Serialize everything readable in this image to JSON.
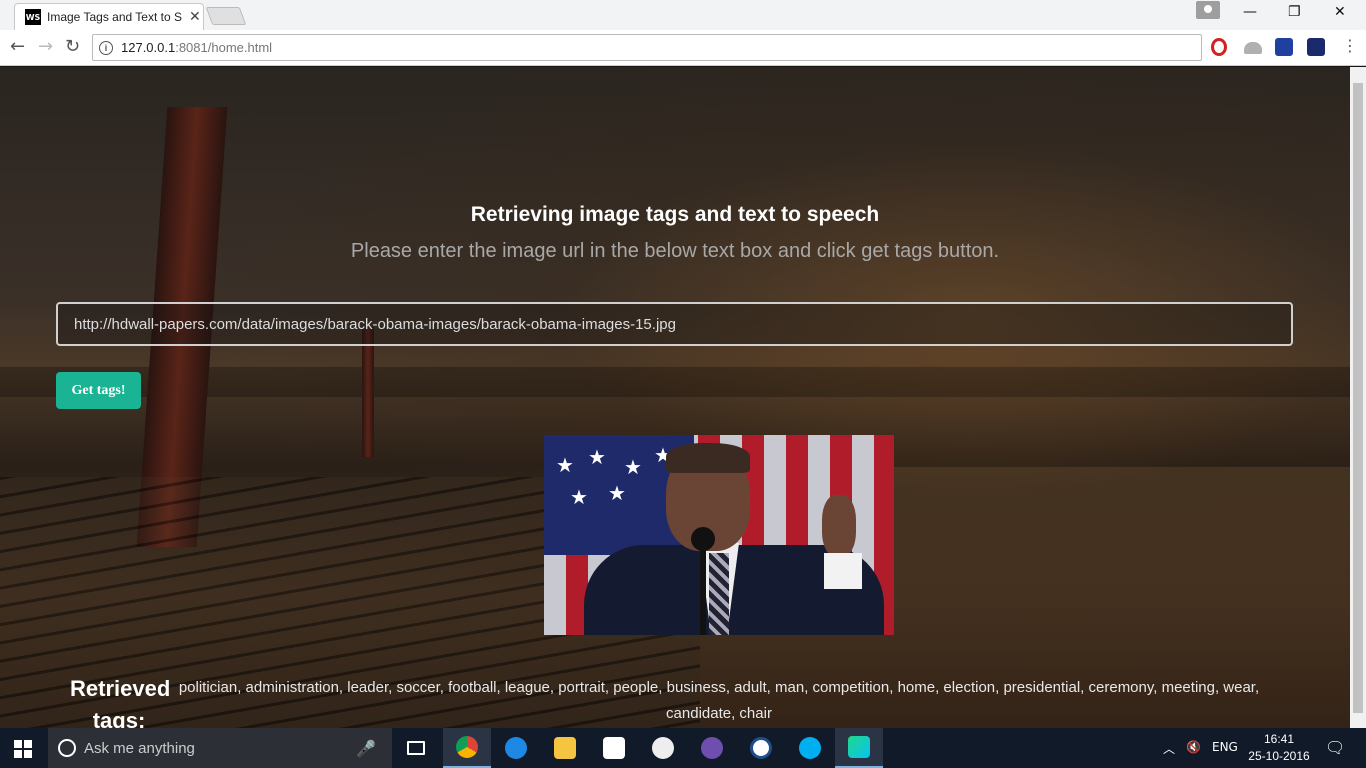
{
  "browser": {
    "tab_title": "Image Tags and Text to S",
    "tab_favicon": "WS",
    "url_host": "127.0.0.1",
    "url_rest": ":8081/home.html"
  },
  "page": {
    "heading": "Retrieving image tags and text to speech",
    "subheading": "Please enter the image url in the below text box and click get tags button.",
    "url_value": "http://hdwall-papers.com/data/images/barack-obama-images/barack-obama-images-15.jpg",
    "button_label": "Get tags!",
    "tags_label": "Retrieved tags:",
    "tags": "politician, administration, leader, soccer, football, league, portrait, people, business, adult, man, competition, home, election, presidential, ceremony, meeting, wear, candidate, chair"
  },
  "taskbar": {
    "search_placeholder": "Ask me anything",
    "language": "ENG",
    "time": "16:41",
    "date": "25-10-2016"
  },
  "colors": {
    "accent_button": "#1ab394",
    "taskbar": "#101a28"
  }
}
